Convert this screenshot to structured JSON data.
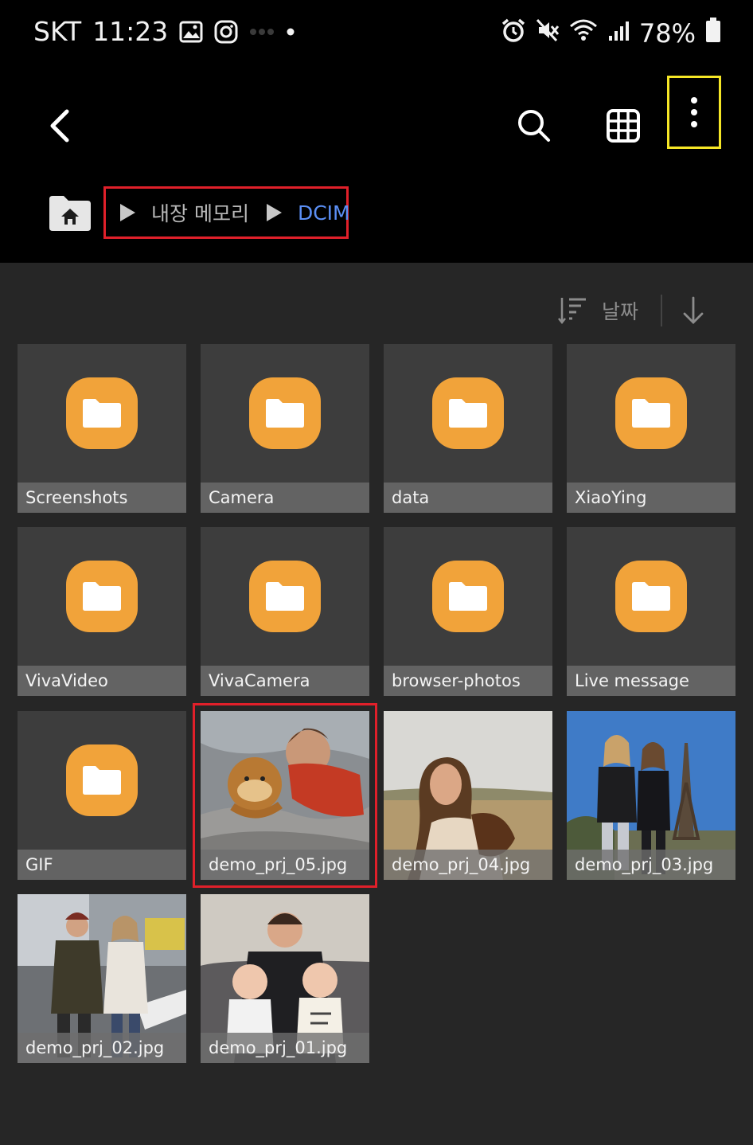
{
  "status_bar": {
    "carrier": "SKT",
    "time": "11:23",
    "battery": "78%",
    "icons_left": [
      "image-icon",
      "instagram-icon",
      "dots-icon",
      "dot-icon"
    ],
    "icons_right": [
      "alarm-icon",
      "mute-icon",
      "wifi-icon",
      "signal-icon",
      "battery-icon"
    ]
  },
  "app_bar": {
    "back_icon": "chevron-left-icon",
    "search_icon": "search-icon",
    "grid_icon": "grid-view-icon",
    "more_icon": "more-vertical-icon"
  },
  "breadcrumb": {
    "home_icon": "home-folder-icon",
    "items": [
      "내장 메모리",
      "DCIM"
    ]
  },
  "sort": {
    "label": "날짜",
    "sort_icon": "sort-icon",
    "direction_icon": "arrow-down-icon"
  },
  "folder_color": "#f1a33a",
  "accent_color": "#5b8ff5",
  "items": [
    {
      "type": "folder",
      "label": "Screenshots"
    },
    {
      "type": "folder",
      "label": "Camera"
    },
    {
      "type": "folder",
      "label": "data"
    },
    {
      "type": "folder",
      "label": "XiaoYing"
    },
    {
      "type": "folder",
      "label": "VivaVideo"
    },
    {
      "type": "folder",
      "label": "VivaCamera"
    },
    {
      "type": "folder",
      "label": "browser-photos"
    },
    {
      "type": "folder",
      "label": "Live message"
    },
    {
      "type": "folder",
      "label": "GIF"
    },
    {
      "type": "image",
      "label": "demo_prj_05.jpg",
      "selected": true
    },
    {
      "type": "image",
      "label": "demo_prj_04.jpg"
    },
    {
      "type": "image",
      "label": "demo_prj_03.jpg"
    },
    {
      "type": "image",
      "label": "demo_prj_02.jpg"
    },
    {
      "type": "image",
      "label": "demo_prj_01.jpg"
    }
  ]
}
